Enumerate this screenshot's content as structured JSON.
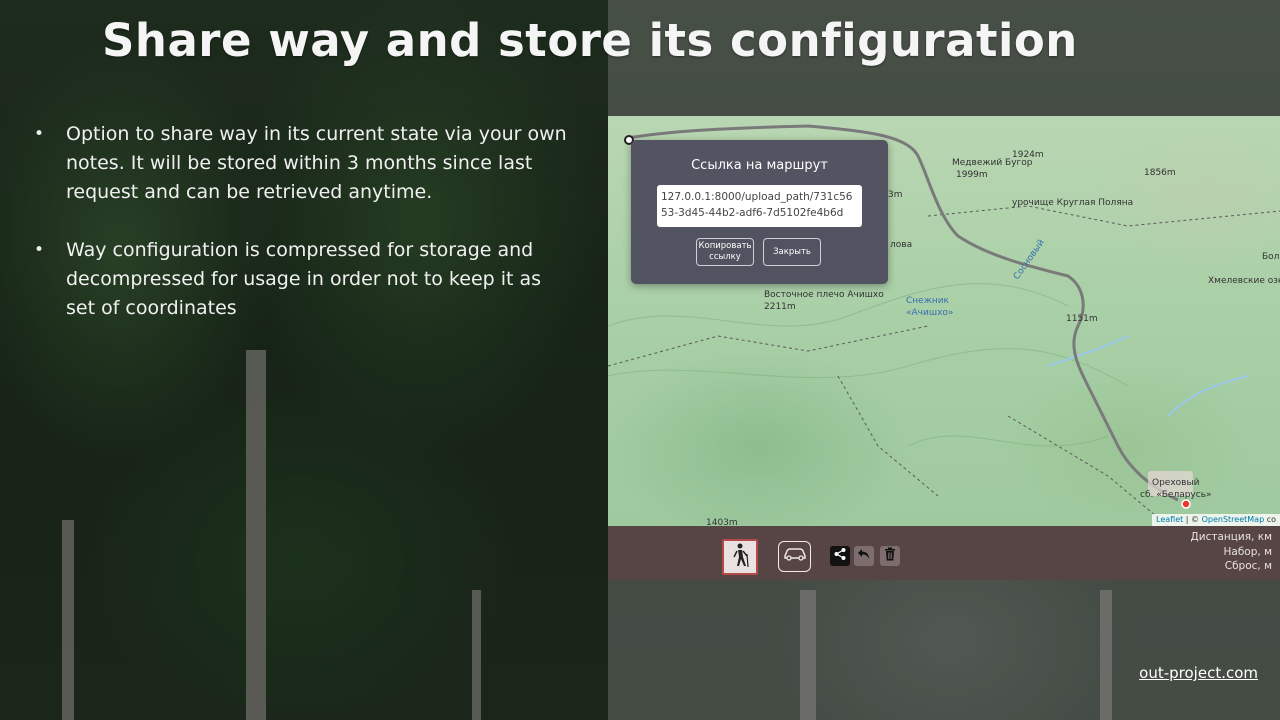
{
  "slide": {
    "title": "Share way and store its configuration",
    "bullets": [
      {
        "text": "Option to share way in its current state via your own notes. It will be stored within 3 months since last request and can be retrieved anytime."
      },
      {
        "text": "Way configuration is compressed for storage and decompressed for usage in order not to keep it as set of coordinates"
      }
    ],
    "footer_link": "out-project.com"
  },
  "map": {
    "labels": {
      "l1924": "1924m",
      "medvezhiy": "Медвежий Бугор",
      "l1999": "1999m",
      "l1856": "1856m",
      "urochishche": "урочище Круглая Поляна",
      "bol": "Бол",
      "l3m": "3m",
      "lova": "лова",
      "khmelevskie": "Хмелевские озе",
      "vostochnoe": "Восточное плечо Ачишхо",
      "l2211": "2211m",
      "snezhnik": "Снежник",
      "achishkho": "«Ачишхо»",
      "sosnovy": "Сосновый",
      "l1151": "1151m",
      "orekhovy": "Ореховый",
      "belarus": "сб. «Беларусь»",
      "l1403": "1403m"
    },
    "attribution": {
      "leaflet": "Leaflet",
      "sep": " | © ",
      "osm": "OpenStreetMap",
      "tail": " co"
    }
  },
  "share_dialog": {
    "title": "Ссылка на маршрут",
    "link": "127.0.0.1:8000/upload_path/731c5653-3d45-44b2-adf6-7d5102fe4b6d",
    "copy_label_1": "Копировать",
    "copy_label_2": "ссылку",
    "close_label": "Закрыть"
  },
  "toolbar": {
    "walk_icon": "hiker-icon",
    "car_icon": "car-icon",
    "share_icon": "share-icon",
    "undo_icon": "undo-icon",
    "trash_icon": "trash-icon",
    "stats": {
      "distance": "Дистанция, км",
      "gain": "Набор, м",
      "loss": "Сброс, м"
    }
  },
  "colors": {
    "toolbar_bg": "#574545",
    "dialog_bg": "#4c4a5c",
    "route": "#7a7a7a",
    "walk_active_border": "#b44a4a"
  }
}
